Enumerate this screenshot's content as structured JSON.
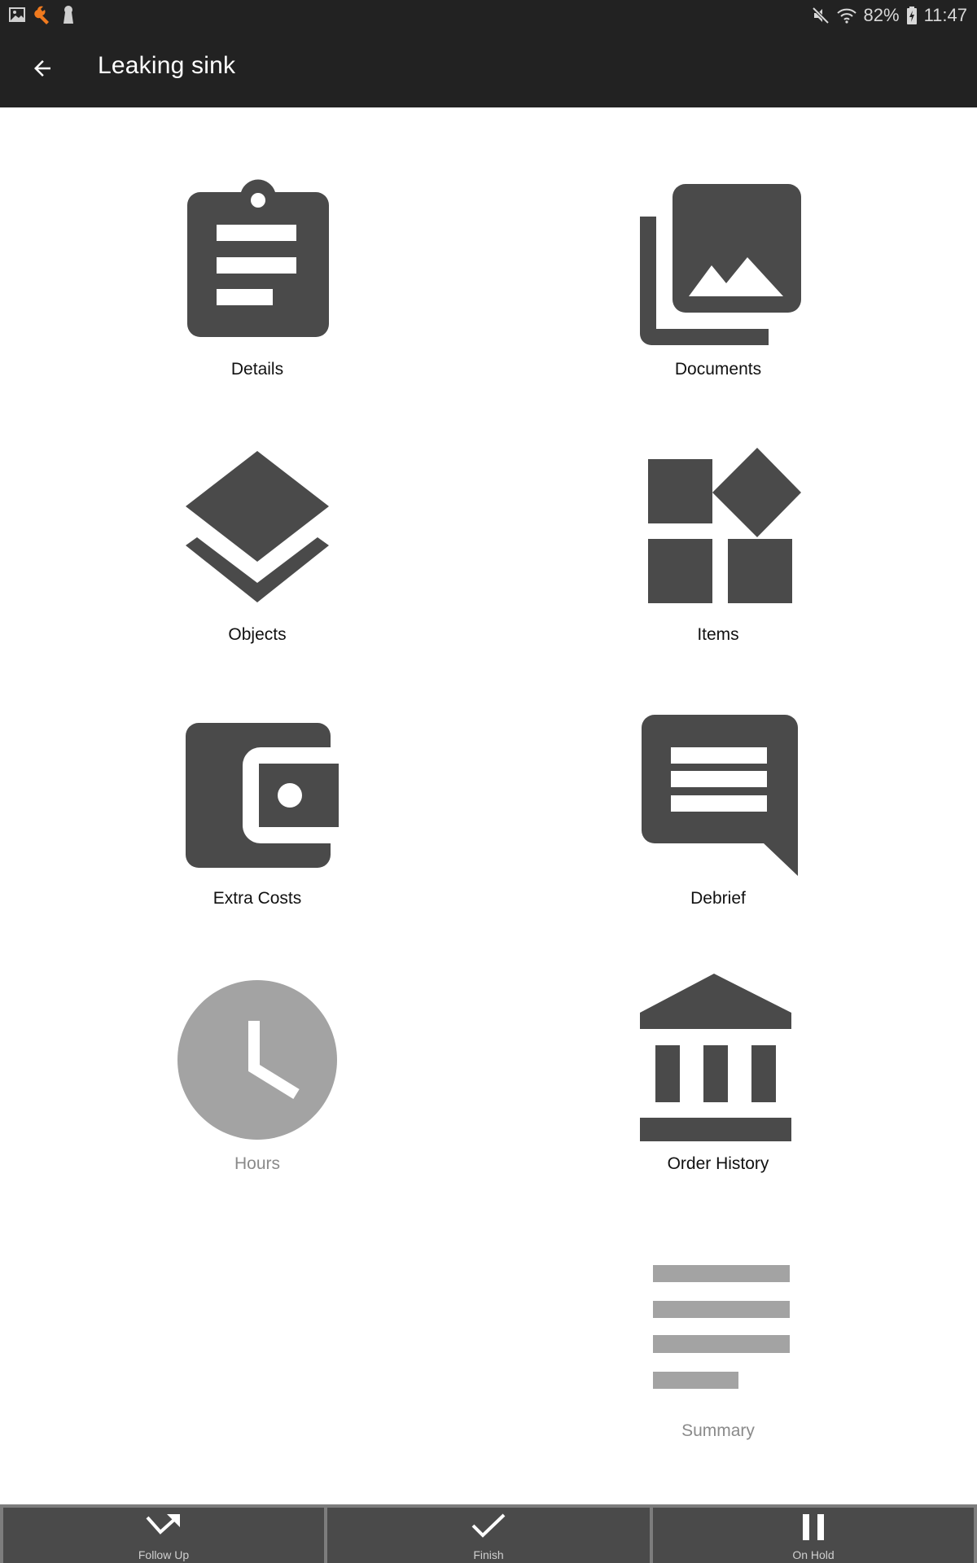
{
  "status_bar": {
    "left_icons": [
      "image-notification-icon",
      "wrench-icon",
      "keyhole-icon"
    ],
    "right_icons": [
      "mute-icon",
      "wifi-icon",
      "battery-charging-icon"
    ],
    "battery": "82%",
    "time": "11:47",
    "accent_color": "#f07a1e"
  },
  "app_bar": {
    "back_icon": "arrow-left-icon",
    "title": "Leaking sink"
  },
  "tiles": [
    {
      "label": "Details",
      "icon": "clipboard-icon",
      "enabled": true
    },
    {
      "label": "Documents",
      "icon": "photo-library-icon",
      "enabled": true
    },
    {
      "label": "Objects",
      "icon": "layers-icon",
      "enabled": true
    },
    {
      "label": "Items",
      "icon": "widgets-icon",
      "enabled": true
    },
    {
      "label": "Extra Costs",
      "icon": "wallet-icon",
      "enabled": true
    },
    {
      "label": "Debrief",
      "icon": "message-icon",
      "enabled": true
    },
    {
      "label": "Hours",
      "icon": "clock-icon",
      "enabled": false
    },
    {
      "label": "Order History",
      "icon": "bank-icon",
      "enabled": true
    },
    {
      "label": "Summary",
      "icon": "notes-icon",
      "enabled": false
    }
  ],
  "bottom_bar": {
    "buttons": [
      {
        "label": "Follow Up",
        "icon": "follow-up-icon"
      },
      {
        "label": "Finish",
        "icon": "check-icon"
      },
      {
        "label": "On Hold",
        "icon": "pause-icon"
      }
    ]
  },
  "colors": {
    "header_bg": "#222222",
    "icon_enabled": "#4a4a4a",
    "icon_disabled": "#a3a3a3",
    "bottom_bar_bg": "#4a4a4a"
  }
}
